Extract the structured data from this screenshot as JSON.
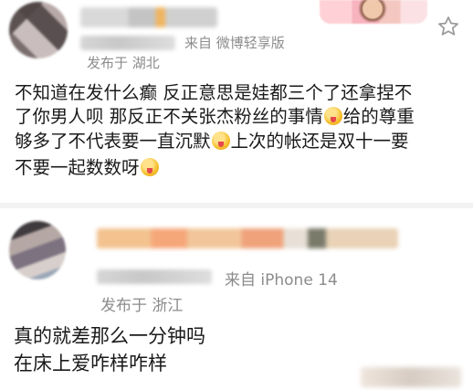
{
  "post1": {
    "source": "来自 微博轻享版",
    "location": "发布于 湖北",
    "lines": [
      [
        "不知道在发什么癫 反正意思是娃都三个了还拿捏不"
      ],
      [
        "了你男人呗 那反正不关张杰粉丝的事情",
        "[emoji]",
        "给的尊重"
      ],
      [
        "够多了不代表要一直沉默",
        "[emoji]",
        "上次的帐还是双十一要"
      ],
      [
        "不要一起数数呀",
        "[emoji]"
      ]
    ],
    "icons": [
      "avatar",
      "favorite-star-icon",
      "tongue-emoji-icon"
    ]
  },
  "post2": {
    "source": "来自 iPhone 14",
    "location": "发布于 浙江",
    "lines": [
      "真的就差那么一分钟吗",
      "在床上爱咋样咋样"
    ]
  },
  "colors": {
    "text": "#1a1a1a",
    "meta": "#8c8c8c",
    "divider": "#f2f2f2"
  }
}
